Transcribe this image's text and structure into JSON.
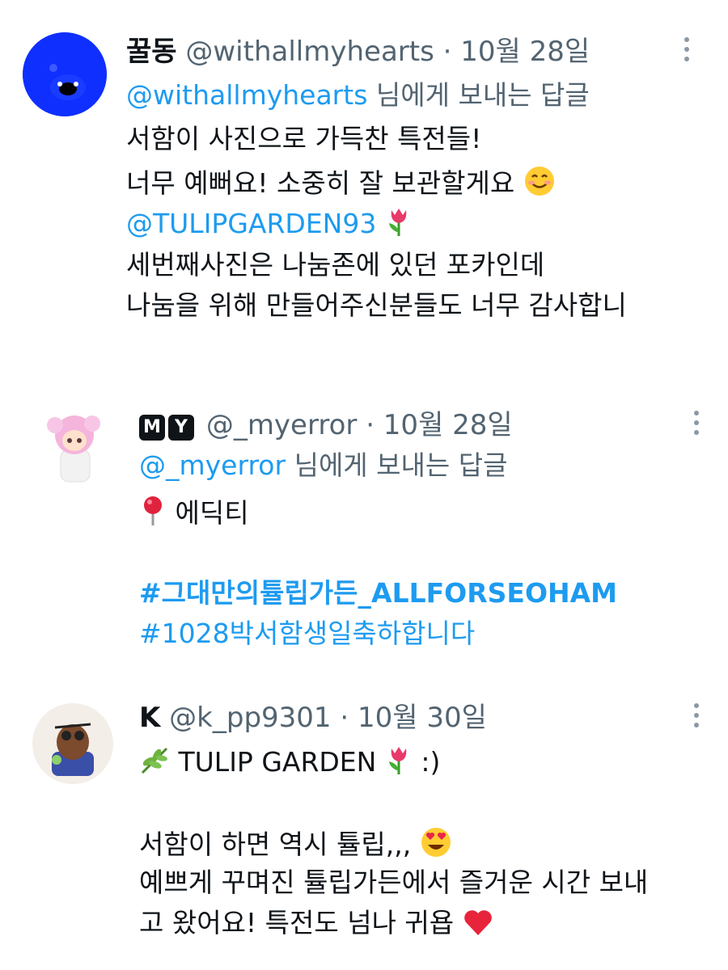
{
  "tweets": [
    {
      "display_name": "꿀동",
      "handle": "@withallmyhearts",
      "date": "· 10월 28일",
      "reply_handle": "@withallmyhearts",
      "reply_suffix": "님에게 보내는 답글",
      "lines": [
        "서함이 사진으로 가득찬 특전들!",
        "너무 예뻐요! 소중히 잘 보관할게요",
        "@TULIPGARDEN93",
        "세번째사진은 나눔존에 있던 포카인데",
        "나눔을 위해 만들어주신분들도 너무 감사합니"
      ],
      "avatar_color": "#0f2fff"
    },
    {
      "display_name_badges": [
        "M",
        "Y"
      ],
      "handle": "@_myerror",
      "date": "· 10월 28일",
      "reply_handle": "@_myerror",
      "reply_suffix": "님에게 보내는 답글",
      "lines": [
        "에딕티",
        "#그대만의튤립가든_ALLFORSEOHAM",
        "#1028박서함생일축하합니다"
      ]
    },
    {
      "display_name": "K",
      "handle": "@k_pp9301",
      "date": "· 10월 30일",
      "lines": [
        "TULIP GARDEN",
        ":)",
        "서함이 하면 역시 튤립,,,",
        "예쁘게 꾸며진 튤립가든에서 즐거운 시간 보내",
        "고 왔어요! 특전도 넘나 귀욥"
      ]
    }
  ],
  "icons": {
    "more": "more-vertical-icon",
    "smile": "smiling-face-emoji",
    "tulip": "tulip-emoji",
    "pin": "round-pushpin-emoji",
    "herb": "herb-emoji",
    "heart_eyes": "heart-eyes-emoji",
    "heart": "red-heart-emoji"
  },
  "colors": {
    "link": "#1d9bf0",
    "meta": "#536471"
  }
}
